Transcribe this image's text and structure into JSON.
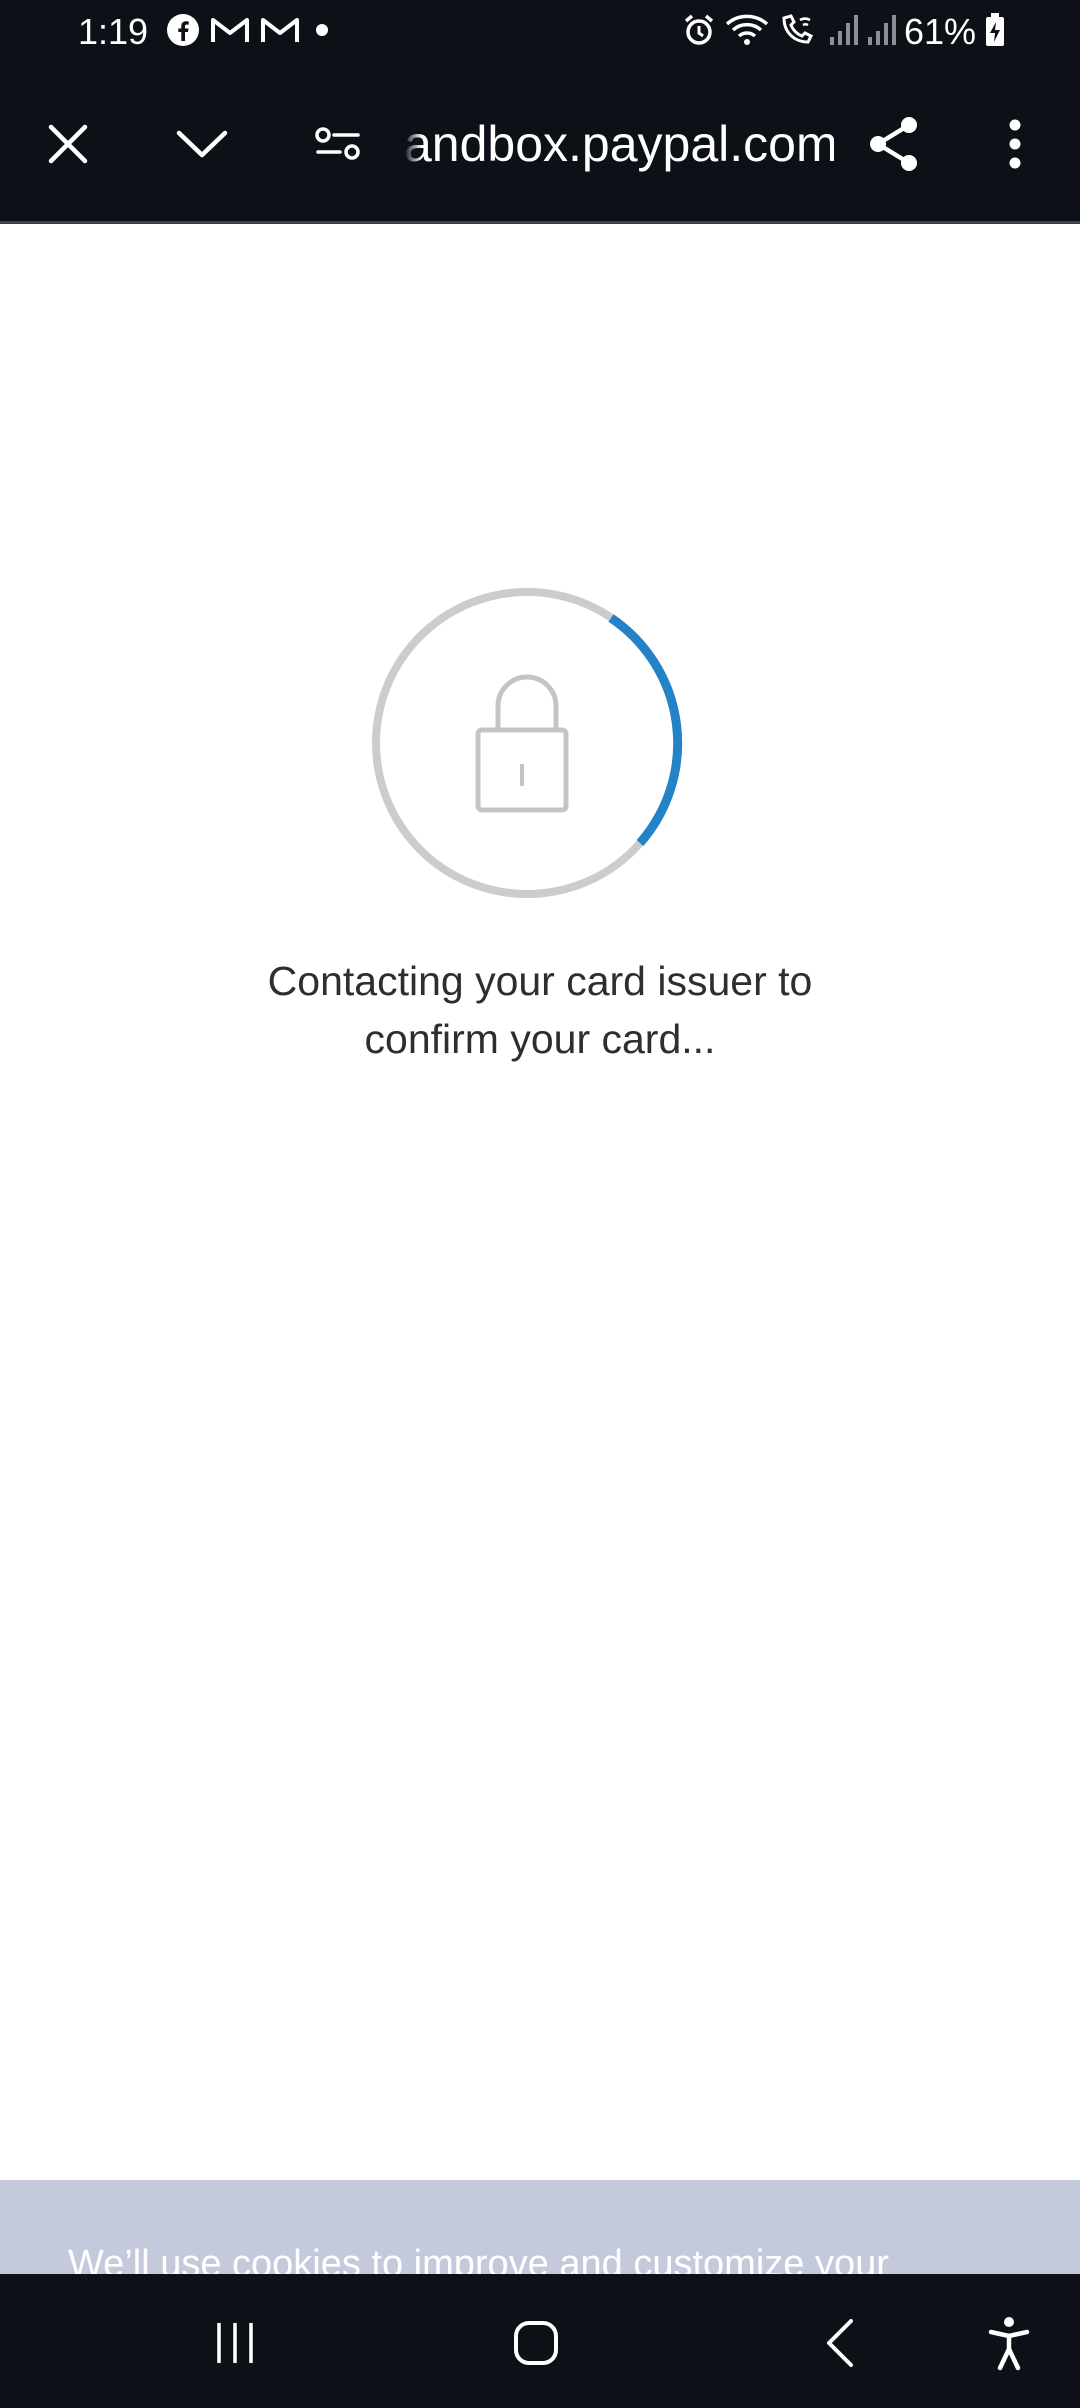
{
  "status_bar": {
    "time": "1:19",
    "battery": "61%",
    "left_icons": [
      "facebook-icon",
      "gmail-icon",
      "gmail-icon",
      "dot-icon"
    ],
    "right_icons": [
      "alarm-icon",
      "wifi-icon",
      "wifi-call-icon",
      "signal-icon",
      "signal-icon",
      "battery-charging-icon"
    ]
  },
  "browser": {
    "url": "andbox.paypal.com",
    "buttons": [
      "close-icon",
      "chevron-down-icon",
      "site-settings-icon",
      "share-icon",
      "more-vert-icon"
    ]
  },
  "main": {
    "spinner_icon": "lock-icon",
    "message": "Contacting your card issuer to\nconfirm your card..."
  },
  "cookie_banner": {
    "text": "We’ll use cookies to improve and customize your"
  },
  "nav_bar": {
    "buttons": [
      "recent-apps-icon",
      "home-icon",
      "back-icon",
      "accessibility-icon"
    ]
  },
  "colors": {
    "bar_background": "#0d1117",
    "spinner_track": "#cccccc",
    "spinner_accent": "#2383c6",
    "cookie_banner": "#c4cadb",
    "text": "#2c2e2f"
  }
}
